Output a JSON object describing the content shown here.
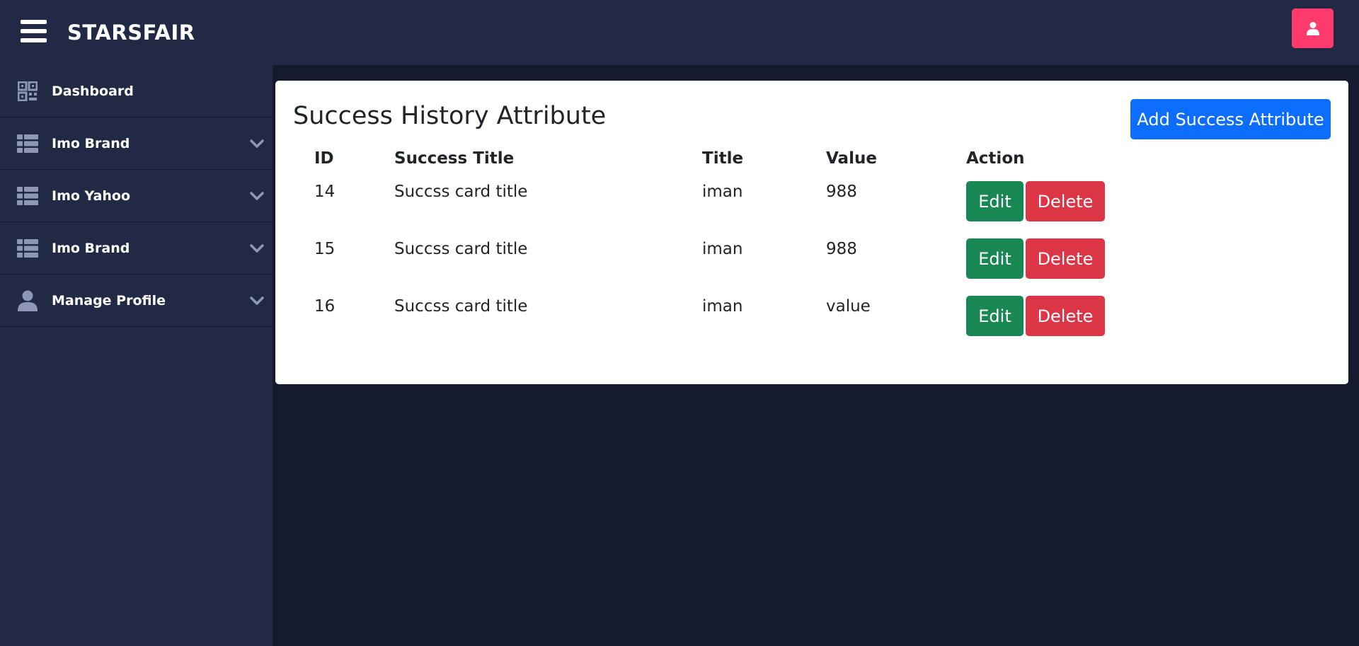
{
  "header": {
    "brand": "STARSFAIR",
    "menu_icon": "hamburger-icon",
    "user_icon": "user-icon",
    "user_button_color": "#ff3b6e"
  },
  "sidebar": {
    "items": [
      {
        "label": "Dashboard",
        "icon": "qrcode-icon",
        "expandable": false
      },
      {
        "label": "Imo Brand",
        "icon": "list-icon",
        "expandable": true
      },
      {
        "label": "Imo Yahoo",
        "icon": "list-icon",
        "expandable": true
      },
      {
        "label": "Imo Brand",
        "icon": "list-icon",
        "expandable": true
      },
      {
        "label": "Manage Profile",
        "icon": "user-icon",
        "expandable": true
      }
    ]
  },
  "main": {
    "title": "Success History Attribute",
    "add_button_label": "Add Success Attribute",
    "table": {
      "columns": [
        "ID",
        "Success Title",
        "Title",
        "Value",
        "Action"
      ],
      "rows": [
        {
          "id": "14",
          "success_title": "Succss card title",
          "title": "iman",
          "value": "988"
        },
        {
          "id": "15",
          "success_title": "Succss card title",
          "title": "iman",
          "value": "988"
        },
        {
          "id": "16",
          "success_title": "Succss card title",
          "title": "iman",
          "value": "value"
        }
      ],
      "edit_label": "Edit",
      "delete_label": "Delete"
    }
  },
  "colors": {
    "topbar": "#212945",
    "background": "#161a2f",
    "primary": "#0d6efd",
    "success": "#198754",
    "danger": "#dc3545"
  }
}
